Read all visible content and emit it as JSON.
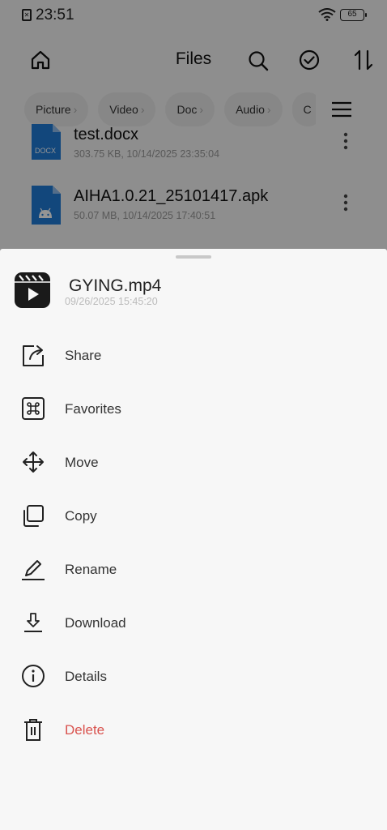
{
  "status_bar": {
    "time": "23:51",
    "battery": "65"
  },
  "header": {
    "title": "Files"
  },
  "chips": [
    "Picture",
    "Video",
    "Doc",
    "Audio",
    "C"
  ],
  "files": [
    {
      "name": "test.docx",
      "meta": "303.75 KB, 10/14/2025 23:35:04",
      "icon_label": "DOCX",
      "icon": "docx-file-icon"
    },
    {
      "name": "AIHA1.0.21_25101417.apk",
      "meta": "50.07 MB, 10/14/2025 17:40:51",
      "icon_label": "",
      "icon": "apk-file-icon"
    }
  ],
  "sheet": {
    "file_name": "GYING.mp4",
    "file_meta": "09/26/2025 15:45:20",
    "actions": [
      {
        "label": "Share",
        "icon": "share-icon"
      },
      {
        "label": "Favorites",
        "icon": "favorites-icon"
      },
      {
        "label": "Move",
        "icon": "move-icon"
      },
      {
        "label": "Copy",
        "icon": "copy-icon"
      },
      {
        "label": "Rename",
        "icon": "rename-icon"
      },
      {
        "label": "Download",
        "icon": "download-icon"
      },
      {
        "label": "Details",
        "icon": "details-icon"
      },
      {
        "label": "Delete",
        "icon": "delete-icon"
      }
    ]
  },
  "colors": {
    "accent_blue": "#1f7ad6",
    "danger": "#d9534f",
    "scrim": "rgba(0,0,0,0.42)"
  }
}
